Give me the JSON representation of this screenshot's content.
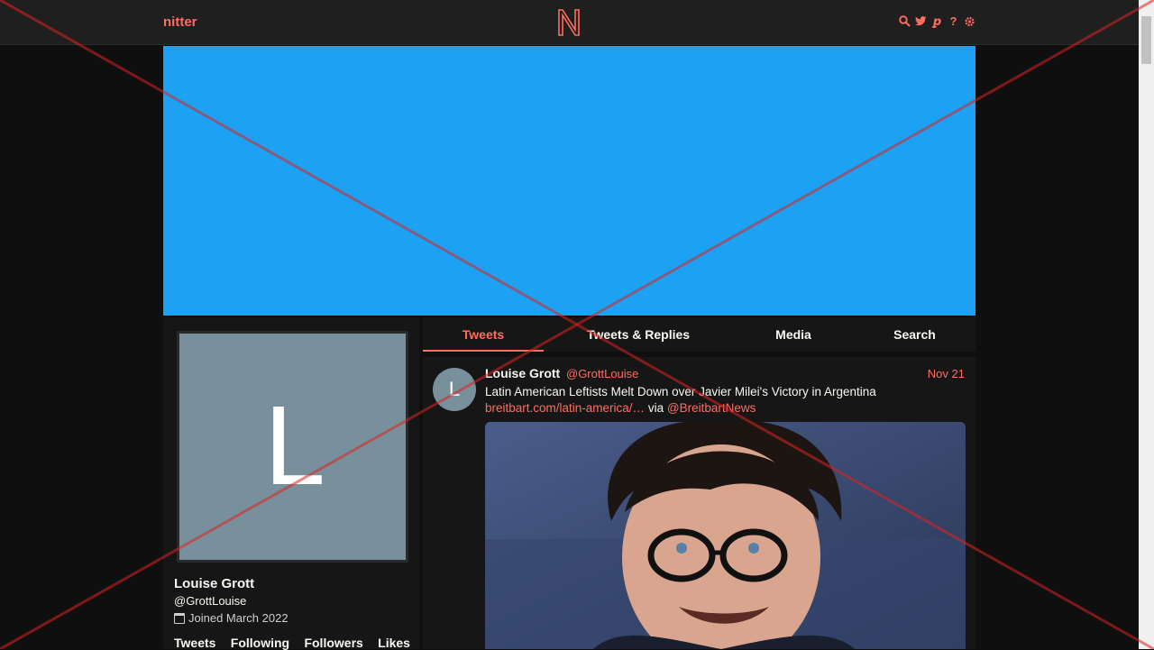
{
  "navbar": {
    "brand": "nitter",
    "icons": [
      "search-icon",
      "twitter-icon",
      "rss-icon",
      "help-icon",
      "gear-icon"
    ],
    "icon_glyphs": [
      "⚲",
      "🐦",
      "ꝑ",
      "?",
      "⚙"
    ]
  },
  "colors": {
    "accent": "#ff6c60",
    "banner": "#1da1f2",
    "avatar": "#78909c",
    "background": "#0f0f0f",
    "panel": "#161616"
  },
  "profile": {
    "avatar_letter": "L",
    "fullname": "Louise Grott",
    "username": "@GrottLouise",
    "joined": "Joined March 2022",
    "stats": [
      "Tweets",
      "Following",
      "Followers",
      "Likes"
    ]
  },
  "tabs": [
    {
      "label": "Tweets",
      "active": true
    },
    {
      "label": "Tweets & Replies",
      "active": false
    },
    {
      "label": "Media",
      "active": false
    },
    {
      "label": "Search",
      "active": false
    }
  ],
  "tweet": {
    "avatar_letter": "L",
    "fullname": "Louise Grott",
    "username": "@GrottLouise",
    "date": "Nov 21",
    "text": "Latin American Leftists Melt Down over Javier Milei's Victory in Argentina",
    "link": "breitbart.com/latin-america/…",
    "via": "via",
    "via_handle": "@BreitbartNews"
  }
}
